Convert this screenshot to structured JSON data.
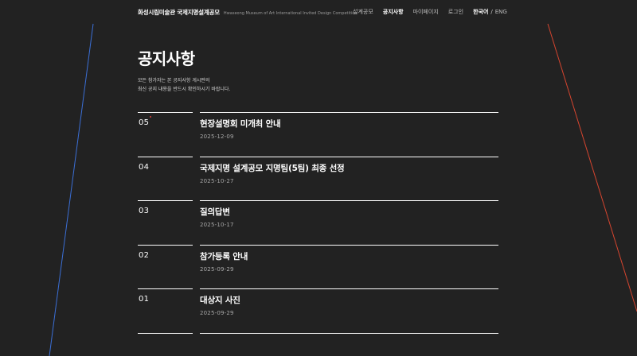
{
  "header": {
    "brand_ko": "화성시립미술관 국제지명설계공모",
    "brand_en": "Hwaseong Museum of Art International Invited Design Competition",
    "nav": [
      {
        "label": "설계공모",
        "active": false
      },
      {
        "label": "공지사항",
        "active": true
      },
      {
        "label": "마이페이지",
        "active": false
      },
      {
        "label": "로그인",
        "active": false
      }
    ],
    "lang": {
      "ko": "한국어",
      "sep": "/",
      "en": "ENG"
    }
  },
  "main": {
    "title": "공지사항",
    "description_line1": "모든 참가자는 본 공지사항 게시판의",
    "description_line2": "최신 공지 내용을 반드시 확인하시기 바랍니다."
  },
  "notices": [
    {
      "num": "05",
      "title": "현장설명회 미개최 안내",
      "date": "2025-12-09",
      "is_new": true
    },
    {
      "num": "04",
      "title": "국제지명 설계공모 지명팀(5팀) 최종 선정",
      "date": "2025-10-27",
      "is_new": false
    },
    {
      "num": "03",
      "title": "질의답변",
      "date": "2025-10-17",
      "is_new": false
    },
    {
      "num": "02",
      "title": "참가등록 안내",
      "date": "2025-09-29",
      "is_new": false
    },
    {
      "num": "01",
      "title": "대상지 사진",
      "date": "2025-09-29",
      "is_new": false
    }
  ],
  "colors": {
    "background": "#222222",
    "accent_red": "#e0403a",
    "deco_blue": "#3b6fd6",
    "deco_red": "#d6452f"
  }
}
